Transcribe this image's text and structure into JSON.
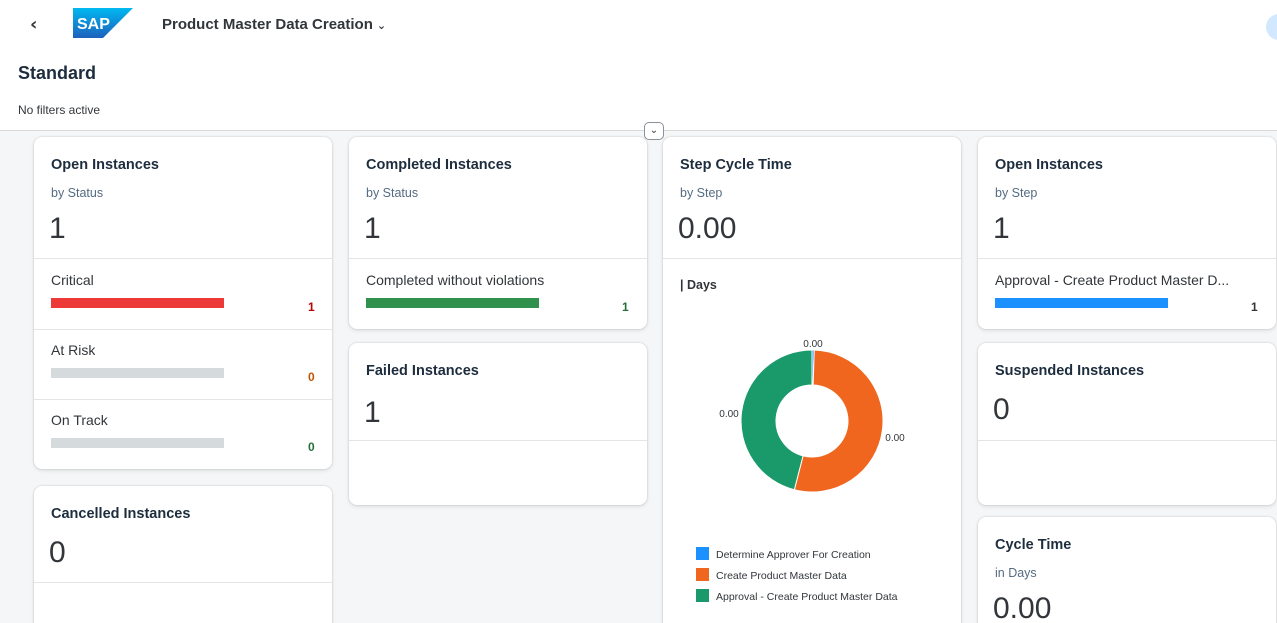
{
  "header": {
    "back_icon": "chevron-left-icon",
    "logo_text": "SAP",
    "app_title": "Product Master Data Creation",
    "title_dropdown_icon": "chevron-down-icon"
  },
  "page": {
    "variant": "Standard",
    "filters_status": "No filters active",
    "collapse_icon": "chevron-down-icon"
  },
  "colors": {
    "critical": "#ee3939",
    "risk": "#e76500",
    "good": "#30914c",
    "blue": "#1b90ff",
    "track": "#d5dadd",
    "orange_slice": "#f0661e",
    "green_slice": "#1a9a6b"
  },
  "cards": {
    "open_status": {
      "title": "Open Instances",
      "subtitle": "by Status",
      "kpi": "1",
      "rows": [
        {
          "label": "Critical",
          "value": "1",
          "fill": 1
        },
        {
          "label": "At Risk",
          "value": "0",
          "fill": 0
        },
        {
          "label": "On Track",
          "value": "0",
          "fill": 0
        }
      ]
    },
    "cancelled": {
      "title": "Cancelled Instances",
      "kpi": "0"
    },
    "completed": {
      "title": "Completed Instances",
      "subtitle": "by Status",
      "kpi": "1",
      "rows": [
        {
          "label": "Completed without violations",
          "value": "1",
          "fill": 1
        }
      ]
    },
    "failed": {
      "title": "Failed Instances",
      "kpi": "1"
    },
    "step_cycle": {
      "title": "Step Cycle Time",
      "subtitle": "by Step",
      "kpi": "0.00",
      "chart_label": "| Days"
    },
    "open_step": {
      "title": "Open Instances",
      "subtitle": "by Step",
      "kpi": "1",
      "rows": [
        {
          "label": "Approval - Create Product Master D...",
          "value": "1",
          "fill": 1
        }
      ]
    },
    "suspended": {
      "title": "Suspended Instances",
      "kpi": "0"
    },
    "cycle_time": {
      "title": "Cycle Time",
      "subtitle": "in Days",
      "kpi": "0.00"
    }
  },
  "chart_data": {
    "type": "pie",
    "title": "",
    "categories": [
      "Determine Approver For Creation",
      "Create Product Master Data",
      "Approval - Create Product Master Data"
    ],
    "values": [
      0.0,
      0.0,
      0.0
    ],
    "visual_shares": [
      0.005,
      0.535,
      0.46
    ],
    "data_labels": [
      "0.00",
      "0.00",
      "0.00"
    ],
    "colors": [
      "#1b90ff",
      "#f0661e",
      "#1a9a6b"
    ],
    "legend": "bottom"
  }
}
